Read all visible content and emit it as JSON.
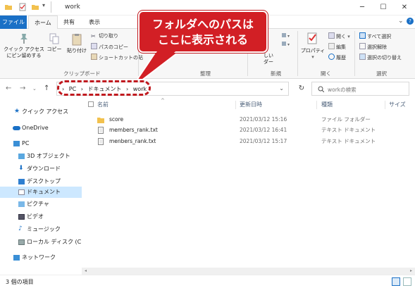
{
  "window": {
    "title": "work",
    "minimize": "─",
    "maximize": "☐",
    "close": "✕"
  },
  "ribbon_tabs": [
    "ファイル",
    "ホーム",
    "共有",
    "表示"
  ],
  "ribbon": {
    "pin_label_1": "クイック アクセス",
    "pin_label_2": "にピン留めする",
    "copy": "コピー",
    "paste": "貼り付け",
    "cut": "切り取り",
    "copy_path": "パスのコピー",
    "paste_shortcut": "ショートカットの貼",
    "new_label_1": "しい",
    "new_label_2": "ダー",
    "properties": "プロパティ",
    "open": "開く",
    "edit": "編集",
    "history": "履歴",
    "select_all": "すべて選択",
    "select_none": "選択解除",
    "invert_selection": "選択の切り替え",
    "groups": [
      "クリップボード",
      "整理",
      "新規",
      "開く",
      "選択"
    ]
  },
  "callout": {
    "line1": "フォルダへのパスは",
    "line2": "ここに表示される"
  },
  "address": {
    "crumbs": [
      "PC",
      "ドキュメント",
      "work"
    ],
    "sep": "›",
    "search_placeholder": "workの検索"
  },
  "nav": [
    {
      "label": "クイック アクセス",
      "icon": "star-icon"
    },
    {
      "label": "OneDrive",
      "icon": "cloud-icon"
    },
    {
      "label": "PC",
      "icon": "pc-icon"
    },
    {
      "label": "3D オブジェクト",
      "icon": "cube-icon"
    },
    {
      "label": "ダウンロード",
      "icon": "download-icon"
    },
    {
      "label": "デスクトップ",
      "icon": "desktop-icon"
    },
    {
      "label": "ドキュメント",
      "icon": "document-icon",
      "selected": true
    },
    {
      "label": "ピクチャ",
      "icon": "picture-icon"
    },
    {
      "label": "ビデオ",
      "icon": "video-icon"
    },
    {
      "label": "ミュージック",
      "icon": "music-icon"
    },
    {
      "label": "ローカル ディスク (C:)",
      "icon": "disk-icon"
    },
    {
      "label": "ネットワーク",
      "icon": "network-icon"
    }
  ],
  "columns": [
    "名前",
    "更新日時",
    "種類",
    "サイズ"
  ],
  "files": [
    {
      "name": "score",
      "date": "2021/03/12 15:16",
      "type": "ファイル フォルダー",
      "kind": "folder"
    },
    {
      "name": "members_rank.txt",
      "date": "2021/03/12 16:41",
      "type": "テキスト ドキュメント",
      "kind": "text"
    },
    {
      "name": "menbers_rank.txt",
      "date": "2021/03/12 15:17",
      "type": "テキスト ドキュメント",
      "kind": "text"
    }
  ],
  "status": "3 個の項目",
  "colors": {
    "accent": "#1a70c6",
    "callout": "#d21f25",
    "selection": "#cde8ff",
    "folder": "#f2c14e"
  }
}
